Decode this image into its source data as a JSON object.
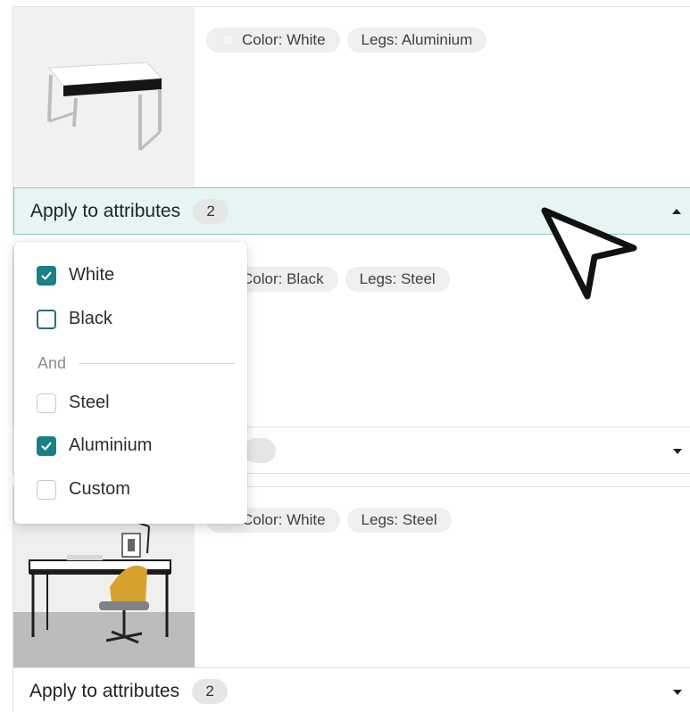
{
  "variants": [
    {
      "tags": [
        {
          "label": "Color: White",
          "swatch": "white"
        },
        {
          "label": "Legs: Aluminium"
        }
      ],
      "apply_label": "Apply to attributes",
      "count": "2",
      "expanded": true
    },
    {
      "tags": [
        {
          "label": "Color: Black",
          "swatch": "black"
        },
        {
          "label": "Legs: Steel"
        }
      ],
      "apply_label": "",
      "count": "",
      "expanded": false
    },
    {
      "tags": [
        {
          "label": "Color: White",
          "swatch": "white"
        },
        {
          "label": "Legs: Steel"
        }
      ],
      "apply_label": "Apply to attributes",
      "count": "2",
      "expanded": false
    }
  ],
  "dropdown": {
    "options": [
      {
        "label": "White",
        "checked": true
      },
      {
        "label": "Black",
        "checked": false
      },
      {
        "label": "Steel",
        "checked": false
      },
      {
        "label": "Aluminium",
        "checked": true
      },
      {
        "label": "Custom",
        "checked": false
      }
    ],
    "separator": "And"
  },
  "colors": {
    "accent": "#1a7f86",
    "open_bar_bg": "#e6f4f4",
    "chip_bg": "#efefef"
  },
  "icons": [
    "checkbox-checked-icon",
    "checkbox-empty-icon",
    "caret-up-icon",
    "caret-down-icon",
    "mouse-pointer-icon"
  ]
}
